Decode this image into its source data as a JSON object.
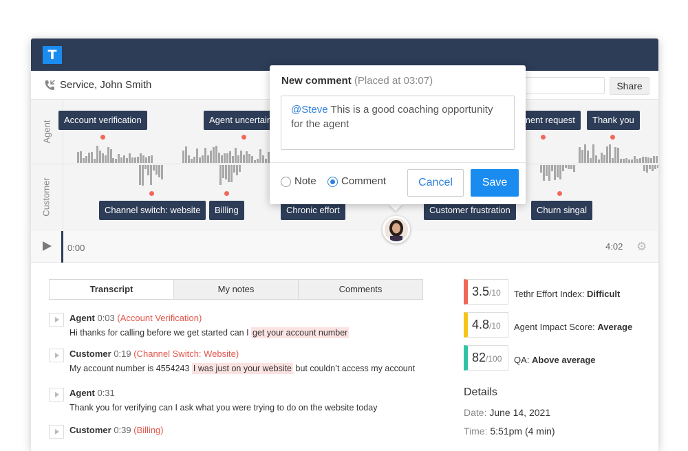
{
  "app": {
    "logo_letter": "T",
    "brand_color": "#1a8cf0",
    "header_color": "#2d3c57"
  },
  "call": {
    "title": "Service, John Smith",
    "share_label": "Share"
  },
  "lanes": {
    "agent_label": "Agent",
    "customer_label": "Customer"
  },
  "tags": {
    "agent": [
      "Account verification",
      "Agent uncertain",
      "ment request",
      "Thank you"
    ],
    "customer": [
      "Channel switch: website",
      "Billing",
      "Chronic effort",
      "Customer frustration",
      "Churn singal"
    ]
  },
  "player": {
    "start": "0:00",
    "end": "4:02"
  },
  "tabs": [
    "Transcript",
    "My notes",
    "Comments"
  ],
  "transcript": [
    {
      "speaker": "Agent",
      "time": "0:03",
      "tag": "Account Verification",
      "pre": "Hi thanks for calling before we get started can I ",
      "hl": "get your account number",
      "post": ""
    },
    {
      "speaker": "Customer",
      "time": "0:19",
      "tag": "Channel Switch: Website",
      "pre": "My account number is 4554243 ",
      "hl": "I was just on your website",
      "post": " but couldn’t access my account"
    },
    {
      "speaker": "Agent",
      "time": "0:31",
      "tag": "",
      "pre": "Thank you for verifying can I ask what you were trying to do on the website today",
      "hl": "",
      "post": ""
    },
    {
      "speaker": "Customer",
      "time": "0:39",
      "tag": "Billing",
      "pre": "",
      "hl": "",
      "post": ""
    }
  ],
  "scores": [
    {
      "value": "3.5",
      "max": "/10",
      "label": "Tethr Effort Index: ",
      "rating": "Difficult",
      "color": "#f2675a"
    },
    {
      "value": "4.8",
      "max": "/10",
      "label": "Agent Impact Score: ",
      "rating": "Average",
      "color": "#f5c518"
    },
    {
      "value": "82",
      "max": "/100",
      "label": "QA: ",
      "rating": "Above average",
      "color": "#2ec4a6"
    }
  ],
  "details": {
    "title": "Details",
    "date_label": "Date:",
    "date": "June 14, 2021",
    "time_label": "Time:",
    "time": "5:51pm (4 min)"
  },
  "popup": {
    "title": "New comment",
    "subtitle": "(Placed at 03:07)",
    "mention": "@Steve",
    "text": " This is a good coaching opportunity for the agent",
    "note_label": "Note",
    "comment_label": "Comment",
    "cancel_label": "Cancel",
    "save_label": "Save"
  }
}
